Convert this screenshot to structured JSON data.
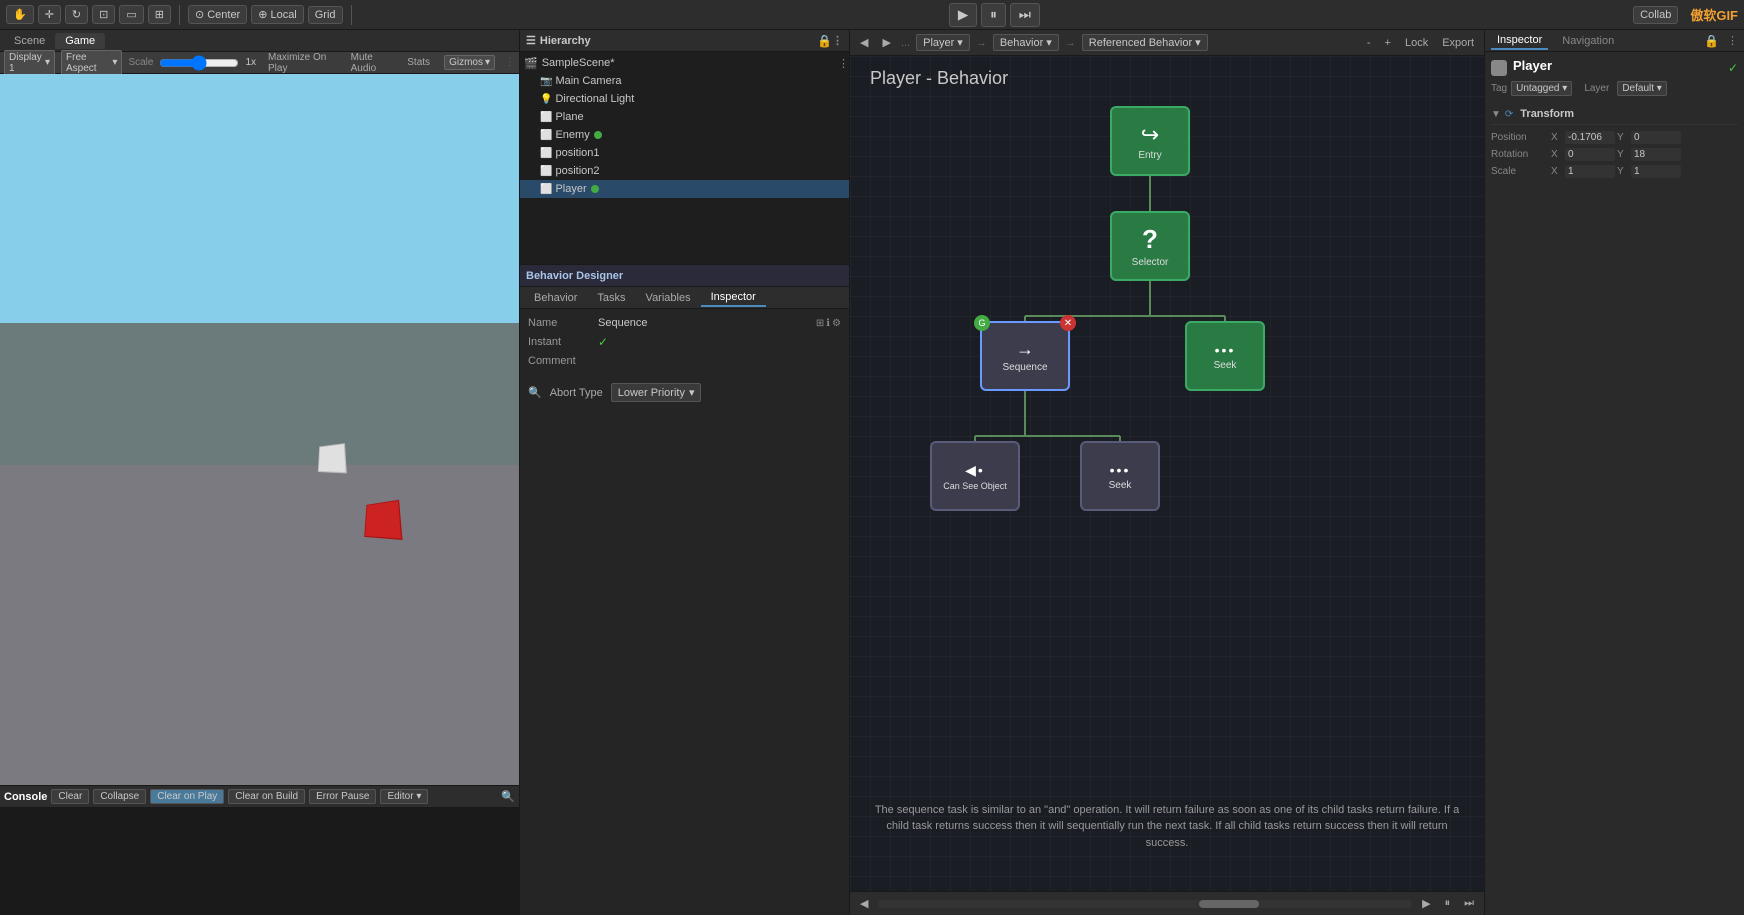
{
  "toolbar": {
    "tools": [
      "hand",
      "move",
      "rotate",
      "scale",
      "rect",
      "transform",
      "custom"
    ],
    "pivot": "Center",
    "space": "Local",
    "grid": "Grid",
    "collab": "Collab",
    "play_label": "▶",
    "pause_label": "⏸",
    "step_label": "⏭"
  },
  "tabs": {
    "scene_label": "Scene",
    "game_label": "Game"
  },
  "game_toolbar": {
    "display_label": "Display 1",
    "aspect_label": "Free Aspect",
    "scale_label": "Scale",
    "scale_value": "1x",
    "maximize_label": "Maximize On Play",
    "mute_label": "Mute Audio",
    "stats_label": "Stats",
    "gizmos_label": "Gizmos"
  },
  "hierarchy": {
    "title": "Hierarchy",
    "scene_name": "SampleScene*",
    "items": [
      {
        "label": "Main Camera",
        "icon": "camera"
      },
      {
        "label": "Directional Light",
        "icon": "light"
      },
      {
        "label": "Plane",
        "icon": "mesh"
      },
      {
        "label": "Enemy",
        "icon": "obj",
        "has_green_dot": true
      },
      {
        "label": "position1",
        "icon": "obj"
      },
      {
        "label": "position2",
        "icon": "obj"
      },
      {
        "label": "Player",
        "icon": "obj",
        "has_green_dot": true
      }
    ]
  },
  "behavior_designer": {
    "title": "Behavior Designer",
    "tabs": [
      "Behavior",
      "Tasks",
      "Variables",
      "Inspector"
    ],
    "active_tab": "Inspector",
    "name_label": "Name",
    "name_value": "Sequence",
    "instant_label": "Instant",
    "instant_checked": true,
    "comment_label": "Comment",
    "abort_type_label": "Abort Type",
    "abort_type_value": "Lower Priority"
  },
  "behavior_graph": {
    "title": "Player - Behavior",
    "toolbar": {
      "back_label": "◀",
      "forward_label": "▶",
      "player_label": "Player",
      "behavior_label": "Behavior",
      "referenced_label": "Referenced Behavior",
      "minus_label": "-",
      "plus_label": "+",
      "lock_label": "Lock",
      "export_label": "Export"
    },
    "nodes": {
      "entry": {
        "label": "Entry"
      },
      "selector": {
        "label": "Selector"
      },
      "sequence": {
        "label": "Sequence"
      },
      "seek_right": {
        "label": "Seek"
      },
      "can_see_object": {
        "label": "Can See Object"
      },
      "seek_bottom": {
        "label": "Seek"
      }
    },
    "description": "The sequence task is similar to an \"and\" operation. It will return failure as soon as one of its child tasks return failure. If a child task returns success then it will sequentially run the next task. If all child tasks return success then it will return success."
  },
  "inspector": {
    "title": "Inspector",
    "navigation_label": "Navigation",
    "player_name": "Player",
    "tag_label": "Tag",
    "tag_value": "Untagged",
    "layer_label": "Layer",
    "transform_label": "Transform",
    "position": {
      "label": "Position",
      "x": "-0.1706",
      "y": "0",
      "z": ""
    },
    "rotation": {
      "label": "Rotation",
      "x": "0",
      "y": "18",
      "z": ""
    },
    "scale": {
      "label": "Scale",
      "x": "1",
      "y": "",
      "z": ""
    }
  },
  "console": {
    "title": "Console",
    "clear_label": "Clear",
    "collapse_label": "Collapse",
    "clear_on_play_label": "Clear on Play",
    "clear_on_build_label": "Clear on Build",
    "error_pause_label": "Error Pause",
    "editor_label": "Editor"
  }
}
